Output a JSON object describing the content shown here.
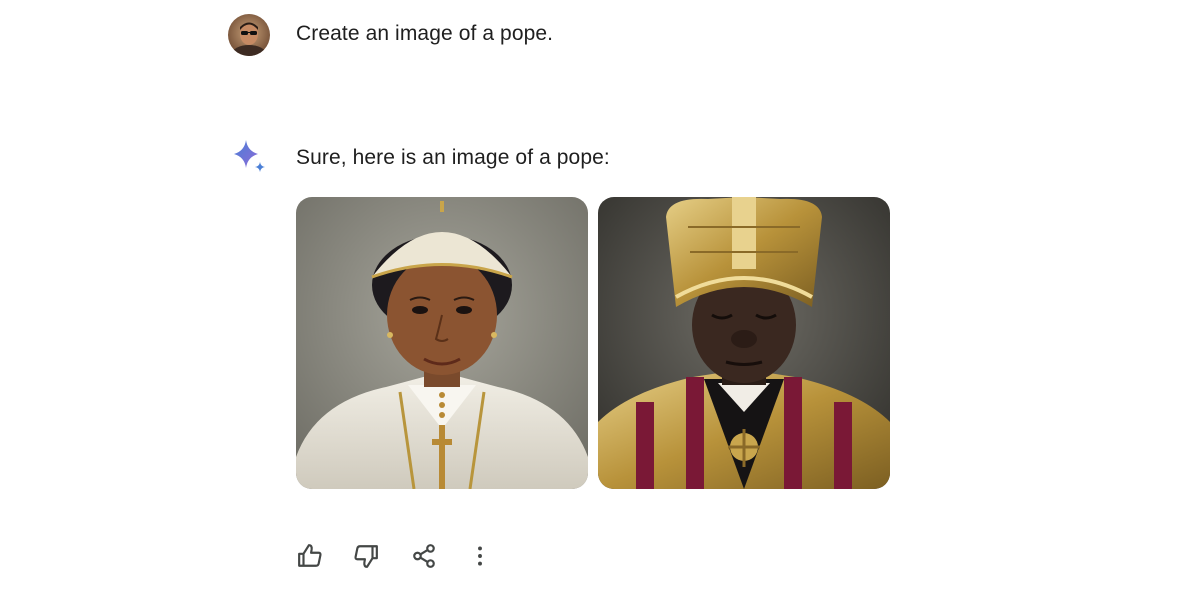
{
  "conversation": {
    "user_message": {
      "text": "Create an image of a pope.",
      "avatar_icon": "user-avatar"
    },
    "assistant_message": {
      "icon": "gemini-sparkle-icon",
      "text": "Sure, here is an image of a pope:",
      "images": [
        {
          "name": "generated-image-1",
          "description_icon": "pope-portrait"
        },
        {
          "name": "generated-image-2",
          "description_icon": "pope-portrait"
        }
      ]
    },
    "actions": [
      {
        "name": "thumbs-up-button",
        "icon": "thumbs-up-icon"
      },
      {
        "name": "thumbs-down-button",
        "icon": "thumbs-down-icon"
      },
      {
        "name": "share-button",
        "icon": "share-icon"
      },
      {
        "name": "more-options-button",
        "icon": "more-vertical-icon"
      }
    ]
  },
  "colors": {
    "text": "#1f1f1f",
    "icon": "#444746",
    "spark_blue": "#4a7fd6",
    "spark_purple": "#8e6ad8"
  }
}
